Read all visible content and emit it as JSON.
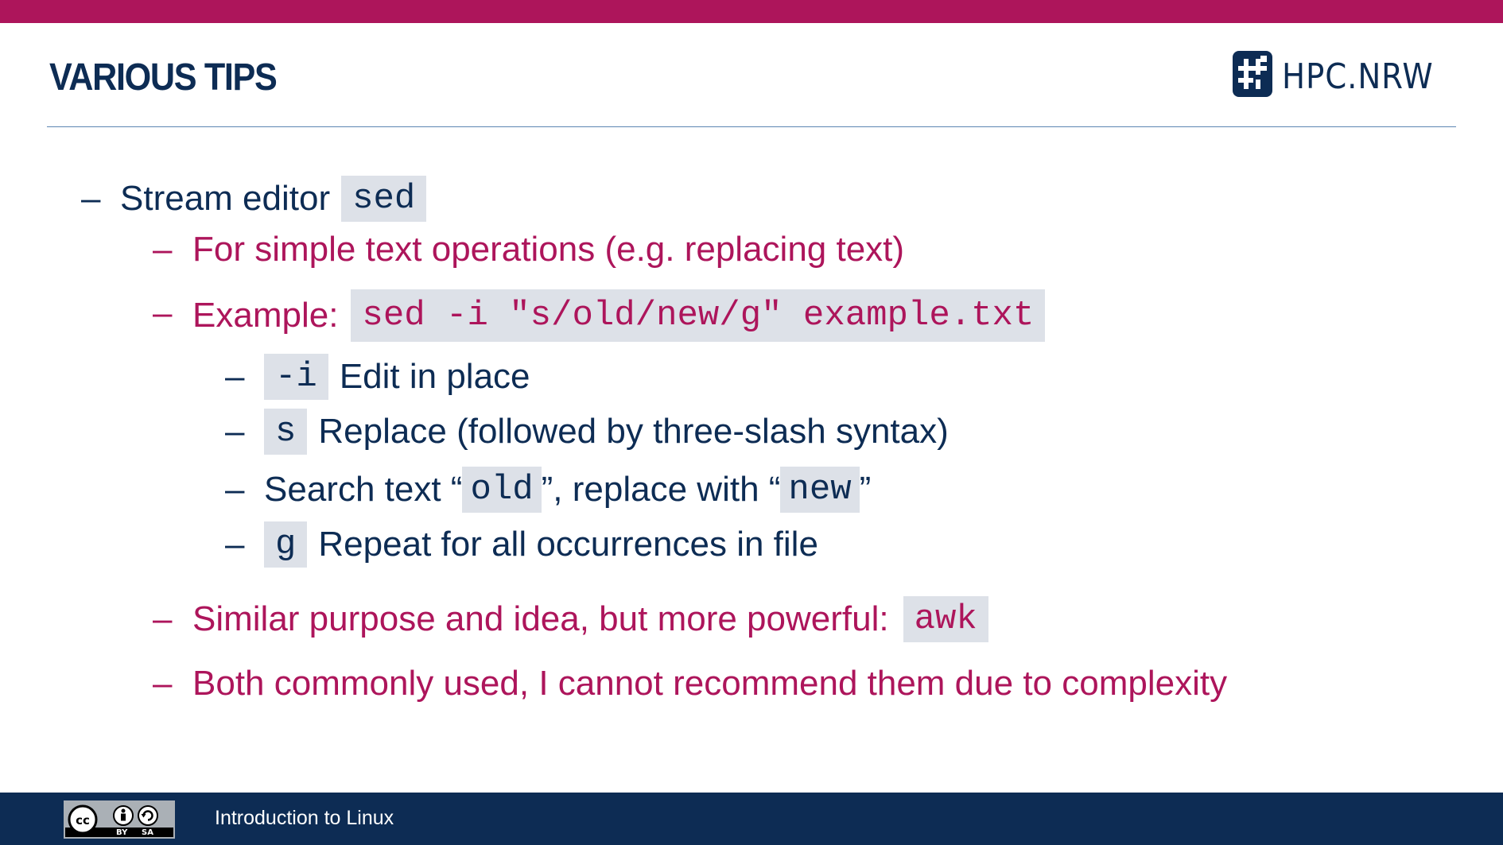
{
  "slide": {
    "title": "VARIOUS TIPS"
  },
  "logo": {
    "text": "HPC.NRW",
    "icon": "hash-logo-icon"
  },
  "colors": {
    "accent": "#ad155b",
    "navy": "#0d2c54",
    "code_bg": "#dde1e8",
    "rule": "#5c86b2"
  },
  "bullets": {
    "dash": "–",
    "l1": {
      "text": "Stream editor",
      "code": "sed"
    },
    "l2_simple": "For simple text operations (e.g. replacing text)",
    "l2_example": {
      "text": "Example:",
      "code": "sed -i \"s/old/new/g\" example.txt"
    },
    "l3_i": {
      "code": "-i",
      "text": "Edit in place"
    },
    "l3_s": {
      "code": "s",
      "text": "Replace (followed by three-slash syntax)"
    },
    "l3_search": {
      "pre": "Search text “",
      "code1": "old",
      "mid": "”, replace with “",
      "code2": "new",
      "post": "”"
    },
    "l3_g": {
      "code": "g",
      "text": "Repeat for all occurrences in file"
    },
    "l2_similar": {
      "text": "Similar purpose and idea, but more powerful:",
      "code": "awk"
    },
    "l2_both": "Both commonly used, I cannot recommend them due to complexity"
  },
  "footer": {
    "title": "Introduction to Linux",
    "license_icon": "cc-by-sa-icon",
    "license_by": "BY",
    "license_sa": "SA"
  }
}
